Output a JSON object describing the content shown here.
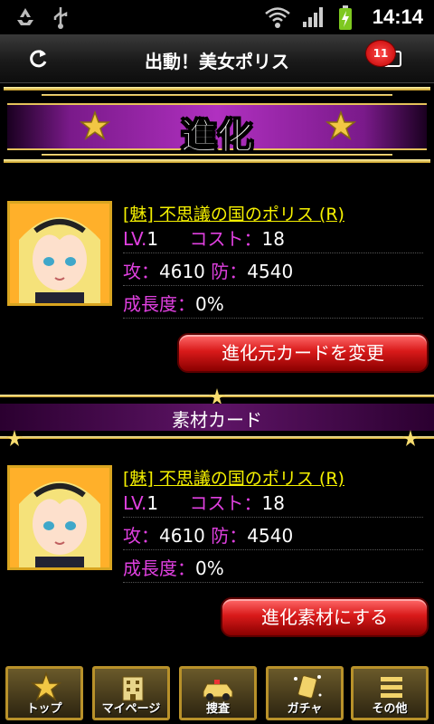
{
  "status": {
    "time": "14:14"
  },
  "header": {
    "title": "出動！美女ポリス",
    "notification_count": "11"
  },
  "banner": {
    "title": "進化"
  },
  "base_card": {
    "name": "[魅] 不思議の国のポリス (R)",
    "level_label": "LV.",
    "level": "1",
    "cost_label": "コスト：",
    "cost": "18",
    "attack_label": "攻：",
    "attack": "4610",
    "defense_label": "防：",
    "defense": "4540",
    "growth_label": "成長度：",
    "growth": "0%",
    "button": "進化元カードを変更"
  },
  "section": {
    "title": "素材カード"
  },
  "material_card": {
    "name": "[魅] 不思議の国のポリス (R)",
    "level_label": "LV.",
    "level": "1",
    "cost_label": "コスト：",
    "cost": "18",
    "attack_label": "攻：",
    "attack": "4610",
    "defense_label": "防：",
    "defense": "4540",
    "growth_label": "成長度：",
    "growth": "0%",
    "button": "進化素材にする"
  },
  "nav": {
    "items": [
      {
        "label": "トップ",
        "icon": "star-badge-icon"
      },
      {
        "label": "マイページ",
        "icon": "building-icon"
      },
      {
        "label": "捜査",
        "icon": "police-car-icon"
      },
      {
        "label": "ガチャ",
        "icon": "card-sparkle-icon"
      },
      {
        "label": "その他",
        "icon": "menu-icon"
      }
    ]
  },
  "colors": {
    "accent_purple": "#b030c0",
    "gold": "#d9a520",
    "button_red": "#d91a1a",
    "label_magenta": "#e040e0",
    "title_yellow": "#f5f000"
  }
}
